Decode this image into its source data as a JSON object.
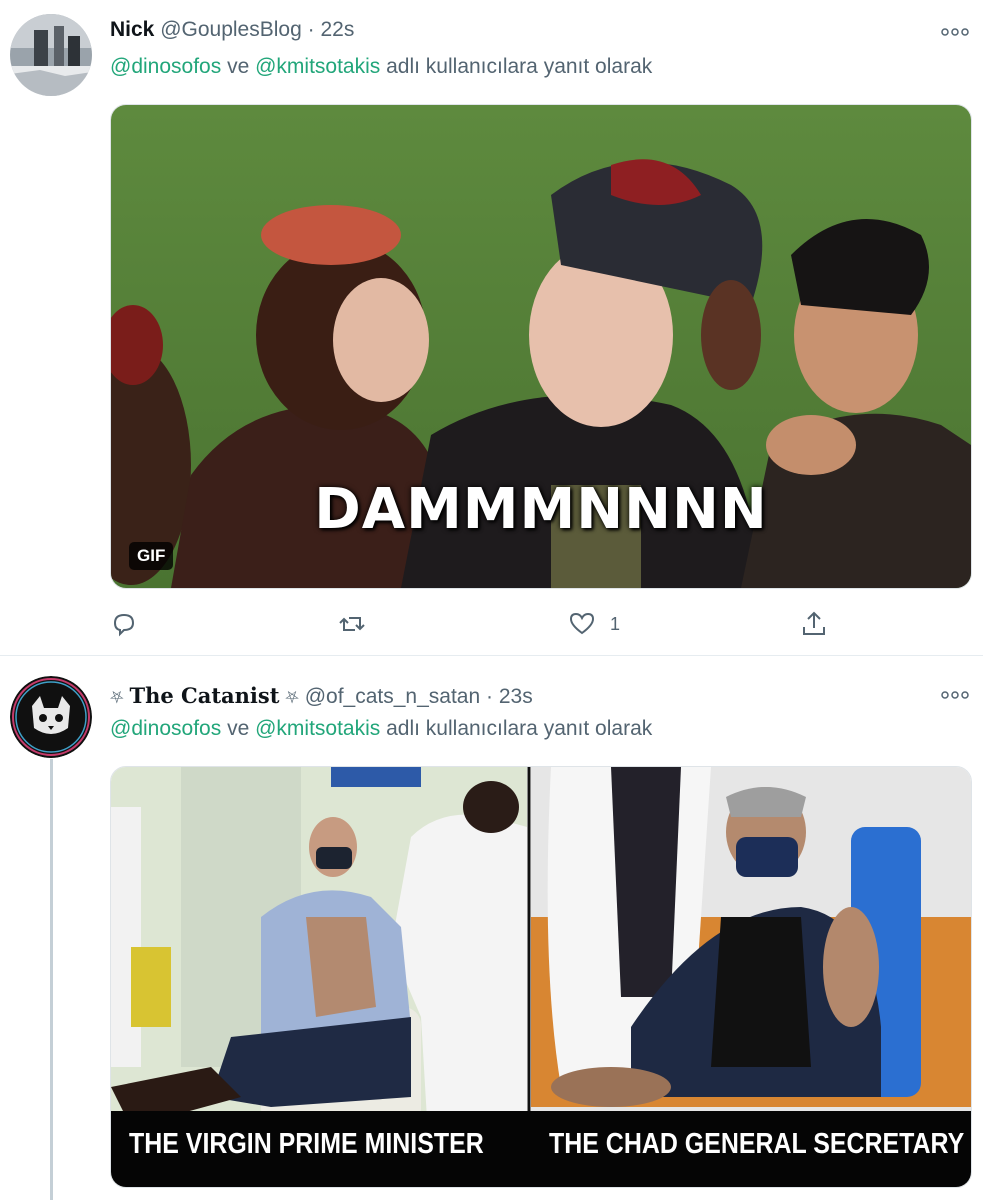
{
  "tweets": [
    {
      "name": "Nick",
      "handle": "@GouplesBlog",
      "time": "22s",
      "reply": {
        "mention1": "@dinosofos",
        "connector": "ve",
        "mention2": "@kmitsotakis",
        "suffix": "adlı kullanıcılara yanıt olarak"
      },
      "media": {
        "type": "gif",
        "caption": "DAMMMNNNN",
        "badge": "GIF"
      },
      "actions": {
        "reply_icon": "reply-icon",
        "retweet_icon": "retweet-icon",
        "like_icon": "heart-icon",
        "like_count": "1",
        "share_icon": "share-icon"
      }
    },
    {
      "name": "The Catanist",
      "name_decoration": "⛧",
      "handle": "@of_cats_n_satan",
      "time": "23s",
      "reply": {
        "mention1": "@dinosofos",
        "connector": "ve",
        "mention2": "@kmitsotakis",
        "suffix": "adlı kullanıcılara yanıt olarak"
      },
      "media": {
        "type": "image",
        "left_caption": "THE VIRGIN PRIME MINISTER",
        "right_caption": "THE CHAD GENERAL SECRETARY"
      }
    }
  ],
  "colors": {
    "mention": "#22a67a",
    "secondary_text": "#536471",
    "divider": "#e6ecf0"
  }
}
